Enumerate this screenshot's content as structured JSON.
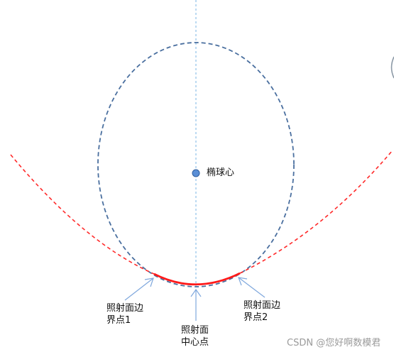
{
  "diagram": {
    "labels": {
      "center": "椭球心",
      "boundary_left_line1": "照射面边",
      "boundary_left_line2": "界点1",
      "center_point_line1": "照射面",
      "center_point_line2": "中心点",
      "boundary_right_line1": "照射面边",
      "boundary_right_line2": "界点2"
    },
    "colors": {
      "ellipse": "#4a6f9f",
      "axis": "#7ab4e6",
      "parabola": "#ff2a2a",
      "arrow": "#7fa8dd",
      "center_dot": "#5b8fd6"
    }
  },
  "watermark": "CSDN @您好啊数模君"
}
